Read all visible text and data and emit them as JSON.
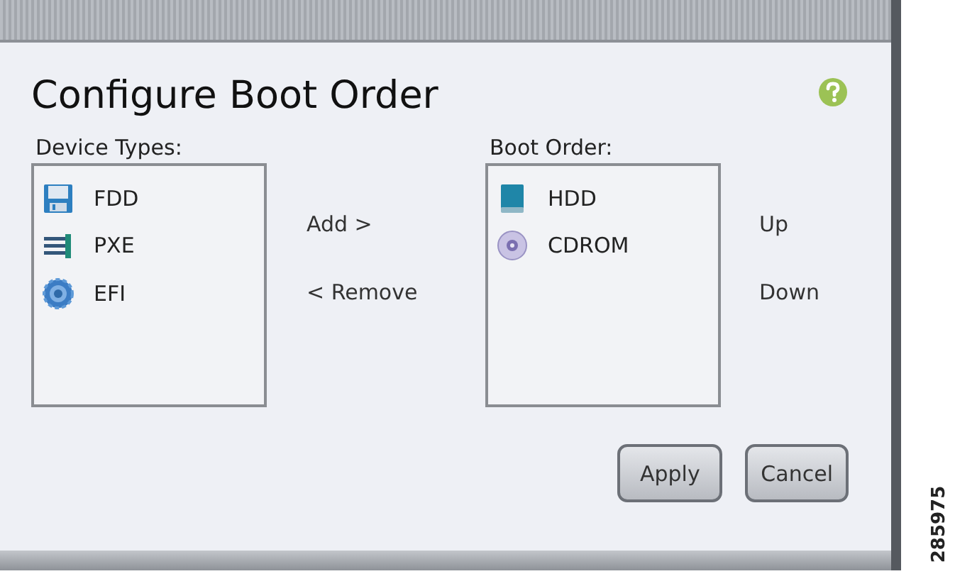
{
  "dialog": {
    "title": "Configure Boot Order"
  },
  "device_types": {
    "label": "Device Types:",
    "items": [
      {
        "name": "FDD",
        "kind": "floppy"
      },
      {
        "name": "PXE",
        "kind": "network"
      },
      {
        "name": "EFI",
        "kind": "gear"
      }
    ]
  },
  "move_actions": [
    "Add >",
    "< Remove"
  ],
  "boot_order": {
    "label": "Boot Order:",
    "items": [
      {
        "name": "HDD",
        "kind": "drive"
      },
      {
        "name": "CDROM",
        "kind": "disc"
      }
    ]
  },
  "order_actions": [
    "Up",
    "Down"
  ],
  "buttons": [
    "Apply",
    "Cancel"
  ],
  "figure_number": "285975"
}
